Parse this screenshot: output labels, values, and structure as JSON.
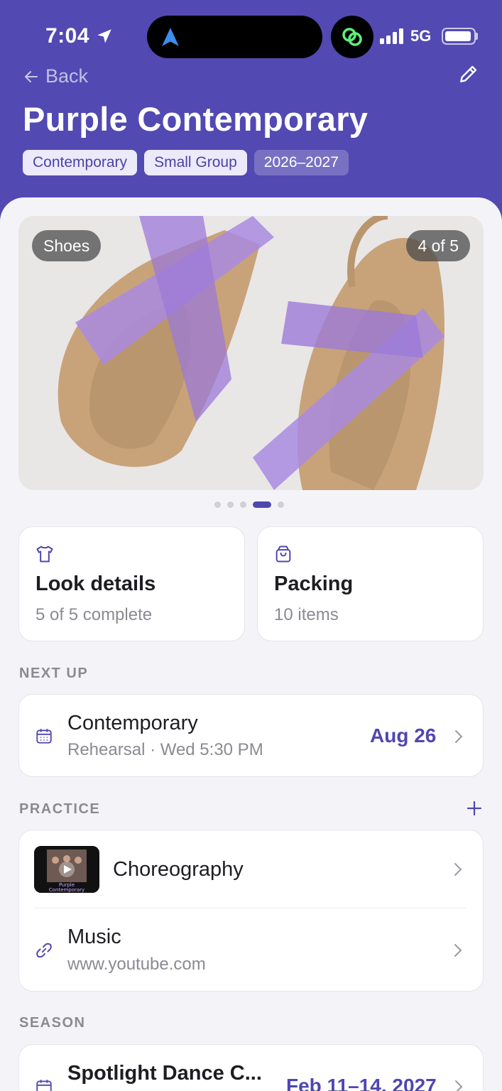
{
  "status_bar": {
    "time": "7:04",
    "network": "5G"
  },
  "header": {
    "back_label": "Back",
    "title": "Purple Contemporary",
    "tags": [
      "Contemporary",
      "Small Group",
      "2026–2027"
    ]
  },
  "gallery": {
    "category_badge": "Shoes",
    "position_label": "4 of 5",
    "page_count": 5,
    "active_index": 3
  },
  "tiles": {
    "look": {
      "icon": "shirt-icon",
      "title": "Look details",
      "subtitle": "5 of 5 complete"
    },
    "packing": {
      "icon": "bag-icon",
      "title": "Packing",
      "subtitle": "10 items"
    }
  },
  "next_up": {
    "label": "NEXT UP",
    "title": "Contemporary",
    "subtitle": "Rehearsal · Wed 5:30 PM",
    "date": "Aug 26"
  },
  "practice": {
    "label": "PRACTICE",
    "items": [
      {
        "title": "Choreography",
        "thumb_caption": "Purple Contemporary"
      },
      {
        "title": "Music",
        "subtitle": "www.youtube.com"
      }
    ]
  },
  "season": {
    "label": "SEASON",
    "title": "Spotlight Dance C...",
    "date": "Feb 11–14, 2027"
  },
  "colors": {
    "brand": "#5249b3",
    "accent": "#4f47b0",
    "background": "#f4f4f8"
  }
}
